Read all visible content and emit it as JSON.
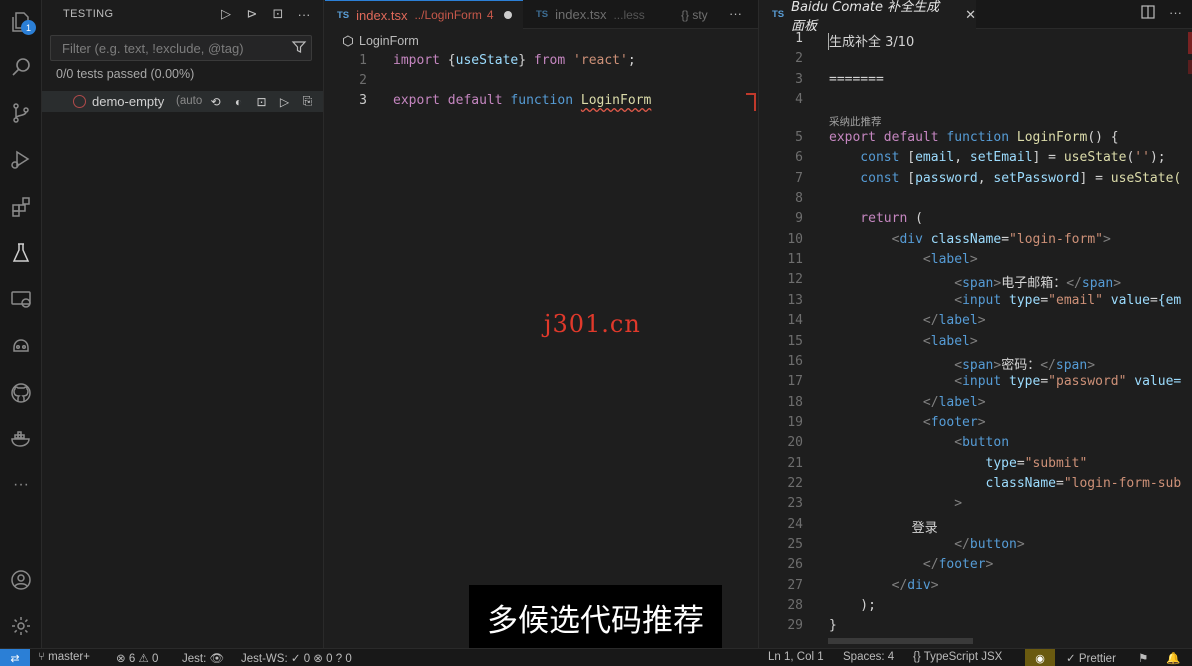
{
  "sidebar": {
    "title": "TESTING",
    "filter_placeholder": "Filter (e.g. text, !exclude, @tag)",
    "passed_text": "0/0 tests passed (0.00%)",
    "test_item": {
      "name": "demo-empty",
      "suffix": "(auto"
    }
  },
  "activity": {
    "badge_count": "1"
  },
  "editor1": {
    "tab_active": {
      "lang": "TS",
      "name": "index.tsx",
      "path": "../LoginForm",
      "problems": "4"
    },
    "tab_second": {
      "lang": "TS",
      "name": "index.tsx",
      "path": "...less"
    },
    "tab_third": {
      "label": "{} sty"
    },
    "breadcrumb": "LoginForm",
    "lines": [
      {
        "num": "1",
        "tokens": [
          {
            "t": "import ",
            "c": "kw2"
          },
          {
            "t": "{",
            "c": "plain"
          },
          {
            "t": "useState",
            "c": "var"
          },
          {
            "t": "} ",
            "c": "plain"
          },
          {
            "t": "from ",
            "c": "kw2"
          },
          {
            "t": "'react'",
            "c": "str"
          },
          {
            "t": ";",
            "c": "plain"
          }
        ]
      },
      {
        "num": "2",
        "tokens": []
      },
      {
        "num": "3",
        "tokens": [
          {
            "t": "export ",
            "c": "kw2"
          },
          {
            "t": "default ",
            "c": "kw2"
          },
          {
            "t": "function ",
            "c": "kw"
          },
          {
            "t": "LoginForm",
            "c": "fn squig"
          }
        ]
      }
    ]
  },
  "editor2": {
    "tab": {
      "lang": "TS",
      "name": "Baidu Comate 补全生成面板"
    },
    "header_line": "生成补全 3/10",
    "separator": "=======",
    "accept_note": "采纳此推荐",
    "lines": [
      {
        "num": "1",
        "tokens": [
          {
            "t": "生成补全 3/10",
            "c": "plain"
          }
        ]
      },
      {
        "num": "2",
        "tokens": []
      },
      {
        "num": "3",
        "tokens": [
          {
            "t": "=======",
            "c": "plain"
          }
        ]
      },
      {
        "num": "4",
        "tokens": []
      },
      {
        "num": "5",
        "tokens": [
          {
            "t": "export ",
            "c": "kw2"
          },
          {
            "t": "default ",
            "c": "kw2"
          },
          {
            "t": "function ",
            "c": "kw"
          },
          {
            "t": "LoginForm",
            "c": "fn"
          },
          {
            "t": "() {",
            "c": "plain"
          }
        ]
      },
      {
        "num": "6",
        "tokens": [
          {
            "t": "    const ",
            "c": "kw"
          },
          {
            "t": "[",
            "c": "plain"
          },
          {
            "t": "email",
            "c": "var"
          },
          {
            "t": ", ",
            "c": "plain"
          },
          {
            "t": "setEmail",
            "c": "var"
          },
          {
            "t": "] = ",
            "c": "plain"
          },
          {
            "t": "useState",
            "c": "fn"
          },
          {
            "t": "(",
            "c": "plain"
          },
          {
            "t": "''",
            "c": "str"
          },
          {
            "t": ");",
            "c": "plain"
          }
        ]
      },
      {
        "num": "7",
        "tokens": [
          {
            "t": "    const ",
            "c": "kw"
          },
          {
            "t": "[",
            "c": "plain"
          },
          {
            "t": "password",
            "c": "var"
          },
          {
            "t": ", ",
            "c": "plain"
          },
          {
            "t": "setPassword",
            "c": "var"
          },
          {
            "t": "] = ",
            "c": "plain"
          },
          {
            "t": "useState(",
            "c": "fn"
          }
        ]
      },
      {
        "num": "8",
        "tokens": []
      },
      {
        "num": "9",
        "tokens": [
          {
            "t": "    return ",
            "c": "kw2"
          },
          {
            "t": "(",
            "c": "plain"
          }
        ]
      },
      {
        "num": "10",
        "tokens": [
          {
            "t": "        <",
            "c": "punc"
          },
          {
            "t": "div ",
            "c": "tag"
          },
          {
            "t": "className",
            "c": "attr"
          },
          {
            "t": "=",
            "c": "plain"
          },
          {
            "t": "\"login-form\"",
            "c": "str"
          },
          {
            "t": ">",
            "c": "punc"
          }
        ]
      },
      {
        "num": "11",
        "tokens": [
          {
            "t": "            <",
            "c": "punc"
          },
          {
            "t": "label",
            "c": "tag"
          },
          {
            "t": ">",
            "c": "punc"
          }
        ]
      },
      {
        "num": "12",
        "tokens": [
          {
            "t": "                <",
            "c": "punc"
          },
          {
            "t": "span",
            "c": "tag"
          },
          {
            "t": ">",
            "c": "punc"
          },
          {
            "t": "电子邮箱：",
            "c": "plain cn"
          },
          {
            "t": "</",
            "c": "punc"
          },
          {
            "t": "span",
            "c": "tag"
          },
          {
            "t": ">",
            "c": "punc"
          }
        ]
      },
      {
        "num": "13",
        "tokens": [
          {
            "t": "                <",
            "c": "punc"
          },
          {
            "t": "input ",
            "c": "tag"
          },
          {
            "t": "type",
            "c": "attr"
          },
          {
            "t": "=",
            "c": "plain"
          },
          {
            "t": "\"email\" ",
            "c": "str"
          },
          {
            "t": "value",
            "c": "attr"
          },
          {
            "t": "=",
            "c": "plain"
          },
          {
            "t": "{em",
            "c": "var"
          }
        ]
      },
      {
        "num": "14",
        "tokens": [
          {
            "t": "            </",
            "c": "punc"
          },
          {
            "t": "label",
            "c": "tag"
          },
          {
            "t": ">",
            "c": "punc"
          }
        ]
      },
      {
        "num": "15",
        "tokens": [
          {
            "t": "            <",
            "c": "punc"
          },
          {
            "t": "label",
            "c": "tag"
          },
          {
            "t": ">",
            "c": "punc"
          }
        ]
      },
      {
        "num": "16",
        "tokens": [
          {
            "t": "                <",
            "c": "punc"
          },
          {
            "t": "span",
            "c": "tag"
          },
          {
            "t": ">",
            "c": "punc"
          },
          {
            "t": "密码：",
            "c": "plain cn"
          },
          {
            "t": "</",
            "c": "punc"
          },
          {
            "t": "span",
            "c": "tag"
          },
          {
            "t": ">",
            "c": "punc"
          }
        ]
      },
      {
        "num": "17",
        "tokens": [
          {
            "t": "                <",
            "c": "punc"
          },
          {
            "t": "input ",
            "c": "tag"
          },
          {
            "t": "type",
            "c": "attr"
          },
          {
            "t": "=",
            "c": "plain"
          },
          {
            "t": "\"password\" ",
            "c": "str"
          },
          {
            "t": "value=",
            "c": "attr"
          }
        ]
      },
      {
        "num": "18",
        "tokens": [
          {
            "t": "            </",
            "c": "punc"
          },
          {
            "t": "label",
            "c": "tag"
          },
          {
            "t": ">",
            "c": "punc"
          }
        ]
      },
      {
        "num": "19",
        "tokens": [
          {
            "t": "            <",
            "c": "punc"
          },
          {
            "t": "footer",
            "c": "tag"
          },
          {
            "t": ">",
            "c": "punc"
          }
        ]
      },
      {
        "num": "20",
        "tokens": [
          {
            "t": "                <",
            "c": "punc"
          },
          {
            "t": "button",
            "c": "tag"
          }
        ]
      },
      {
        "num": "21",
        "tokens": [
          {
            "t": "                    type",
            "c": "attr"
          },
          {
            "t": "=",
            "c": "plain"
          },
          {
            "t": "\"submit\"",
            "c": "str"
          }
        ]
      },
      {
        "num": "22",
        "tokens": [
          {
            "t": "                    className",
            "c": "attr"
          },
          {
            "t": "=",
            "c": "plain"
          },
          {
            "t": "\"login-form-sub",
            "c": "str"
          }
        ]
      },
      {
        "num": "23",
        "tokens": [
          {
            "t": "                >",
            "c": "punc"
          }
        ]
      },
      {
        "num": "24",
        "tokens": [
          {
            "t": "                    登录",
            "c": "plain cn"
          }
        ]
      },
      {
        "num": "25",
        "tokens": [
          {
            "t": "                </",
            "c": "punc"
          },
          {
            "t": "button",
            "c": "tag"
          },
          {
            "t": ">",
            "c": "punc"
          }
        ]
      },
      {
        "num": "26",
        "tokens": [
          {
            "t": "            </",
            "c": "punc"
          },
          {
            "t": "footer",
            "c": "tag"
          },
          {
            "t": ">",
            "c": "punc"
          }
        ]
      },
      {
        "num": "27",
        "tokens": [
          {
            "t": "        </",
            "c": "punc"
          },
          {
            "t": "div",
            "c": "tag"
          },
          {
            "t": ">",
            "c": "punc"
          }
        ]
      },
      {
        "num": "28",
        "tokens": [
          {
            "t": "    );",
            "c": "plain"
          }
        ]
      },
      {
        "num": "29",
        "tokens": [
          {
            "t": "}",
            "c": "plain"
          }
        ]
      }
    ]
  },
  "watermark": "j301.cn",
  "subtitle": "多候选代码推荐",
  "statusbar": {
    "branch": "master+",
    "errors": "6",
    "warnings": "0",
    "jest": "Jest:",
    "jest_ws": "Jest-WS:",
    "ws_pass": "0",
    "ws_fail": "0",
    "ws_unknown": "0",
    "position": "Ln 1, Col 1",
    "spaces": "Spaces: 4",
    "language": "TypeScript JSX",
    "prettier": "Prettier"
  },
  "colors": {
    "accent": "#2b7fd6",
    "error": "#e0695a",
    "background": "#1e1e1e"
  }
}
